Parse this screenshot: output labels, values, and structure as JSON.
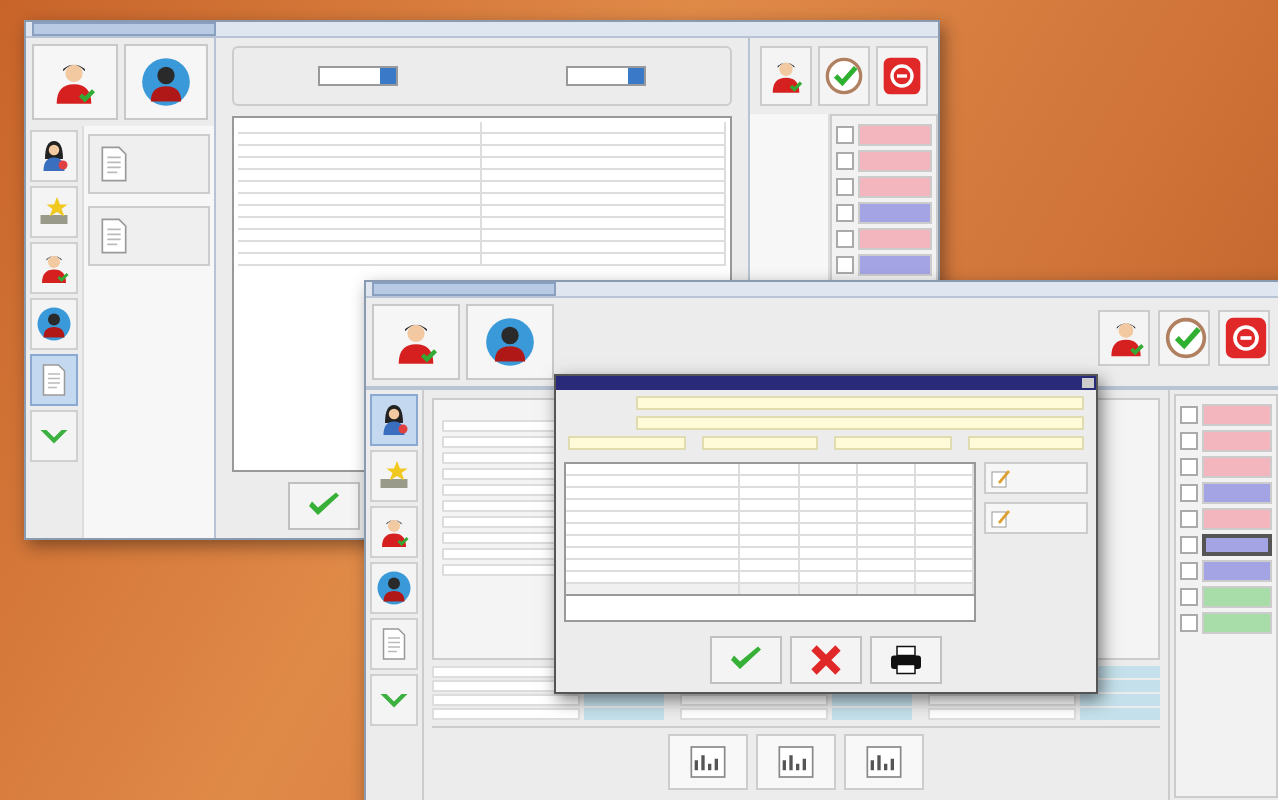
{
  "back_window": {
    "toolbar": [
      {
        "kind": "person"
      },
      {
        "kind": "person-circle"
      }
    ],
    "sidebar": [
      {
        "kind": "woman",
        "selected": false
      },
      {
        "kind": "star",
        "selected": false
      },
      {
        "kind": "person",
        "selected": false
      },
      {
        "kind": "person-circle",
        "selected": false
      },
      {
        "kind": "document",
        "selected": true
      },
      {
        "kind": "arrow",
        "selected": false
      }
    ],
    "reports": [
      {
        "kind": "document"
      },
      {
        "kind": "document"
      }
    ],
    "table_rows": [
      {
        "kind": "data"
      },
      {
        "kind": "data"
      },
      {
        "kind": "data"
      },
      {
        "kind": "data"
      },
      {
        "kind": "data"
      },
      {
        "kind": "data"
      },
      {
        "kind": "data"
      },
      {
        "kind": "data"
      },
      {
        "kind": "data"
      },
      {
        "kind": "data"
      },
      {
        "kind": "data"
      },
      {
        "kind": "data"
      }
    ],
    "actions": [
      {
        "kind": "ok"
      }
    ],
    "top_actions": [
      {
        "kind": "person"
      },
      {
        "kind": "check-circle"
      },
      {
        "kind": "exit"
      }
    ],
    "tiles": [
      {
        "color": "#f4b6be",
        "selected": false,
        "checked": false
      },
      {
        "color": "#f4b6be",
        "selected": false,
        "checked": false
      },
      {
        "color": "#f4b6be",
        "selected": false,
        "checked": false
      },
      {
        "color": "#a4a4e4",
        "selected": false,
        "checked": false
      },
      {
        "color": "#f4b6be",
        "selected": false,
        "checked": false
      },
      {
        "color": "#a4a4e4",
        "selected": false,
        "checked": false
      }
    ]
  },
  "front_window": {
    "toolbar": [
      {
        "kind": "person"
      },
      {
        "kind": "person-circle"
      }
    ],
    "top_actions": [
      {
        "kind": "person"
      },
      {
        "kind": "check-circle"
      },
      {
        "kind": "exit"
      }
    ],
    "sidebar": [
      {
        "kind": "woman",
        "selected": true
      },
      {
        "kind": "star",
        "selected": false
      },
      {
        "kind": "person",
        "selected": false
      },
      {
        "kind": "person-circle",
        "selected": false
      },
      {
        "kind": "document",
        "selected": false
      },
      {
        "kind": "arrow",
        "selected": false
      }
    ],
    "tiles": [
      {
        "color": "#f4b6be",
        "selected": false,
        "checked": false
      },
      {
        "color": "#f4b6be",
        "selected": false,
        "checked": false
      },
      {
        "color": "#f4b6be",
        "selected": false,
        "checked": false
      },
      {
        "color": "#a4a4e4",
        "selected": false,
        "checked": false
      },
      {
        "color": "#f4b6be",
        "selected": false,
        "checked": false
      },
      {
        "color": "#a4a4e4",
        "selected": true,
        "checked": false
      },
      {
        "color": "#a4a4e4",
        "selected": false,
        "checked": false
      },
      {
        "color": "#a8dca8",
        "selected": false,
        "checked": false
      },
      {
        "color": "#a8dca8",
        "selected": false,
        "checked": false
      }
    ],
    "bottom_actions": [
      {
        "kind": "chart"
      },
      {
        "kind": "chart"
      },
      {
        "kind": "chart"
      }
    ],
    "dialog": {
      "table_rows": [
        {
          "kind": "data"
        },
        {
          "kind": "data"
        },
        {
          "kind": "data"
        },
        {
          "kind": "data"
        },
        {
          "kind": "data"
        },
        {
          "kind": "data"
        },
        {
          "kind": "data"
        },
        {
          "kind": "data"
        },
        {
          "kind": "data"
        },
        {
          "kind": "data"
        },
        {
          "kind": "total"
        }
      ],
      "side_buttons": [
        {
          "kind": "edit"
        },
        {
          "kind": "edit"
        }
      ],
      "actions": [
        {
          "kind": "ok"
        },
        {
          "kind": "cancel"
        },
        {
          "kind": "print"
        }
      ]
    }
  }
}
